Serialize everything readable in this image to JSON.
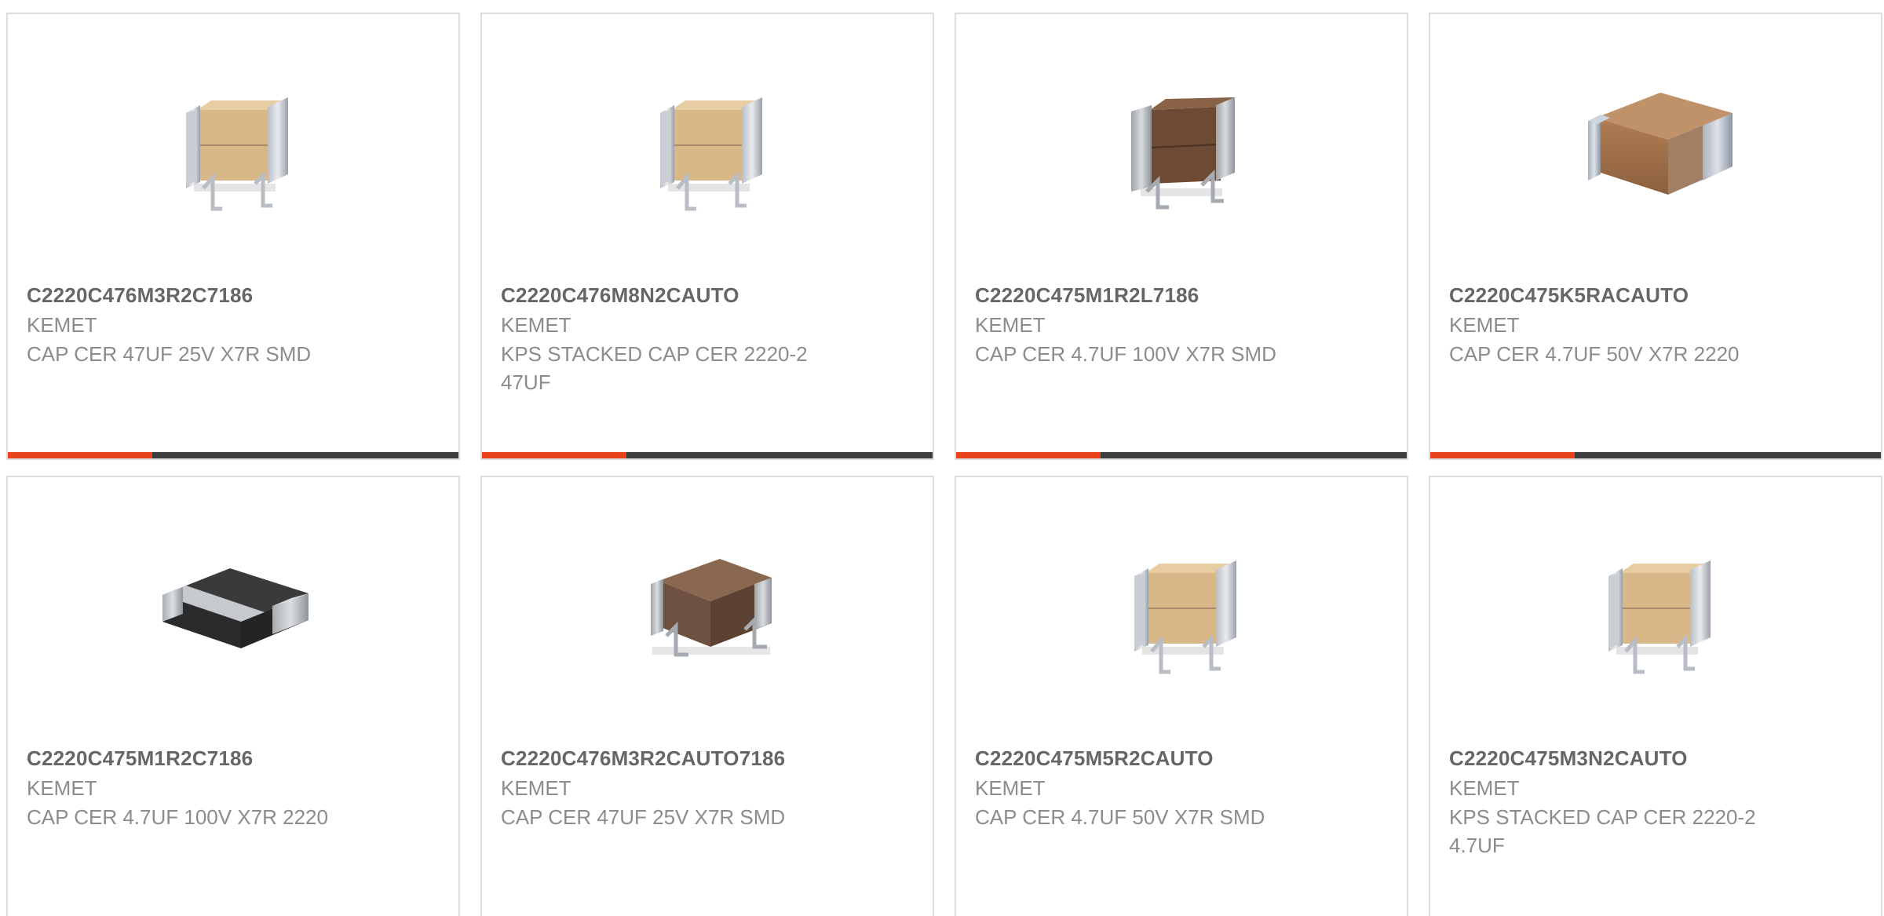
{
  "colors": {
    "accent": "#e8431b",
    "bar_track": "#3e3e3e",
    "border": "#dcdcdc"
  },
  "products": [
    {
      "part_number": "C2220C476M3R2C7186",
      "manufacturer": "KEMET",
      "description": "CAP CER 47UF 25V X7R SMD",
      "image": "stacked-tan-capacitor-icon",
      "progress": 0.32
    },
    {
      "part_number": "C2220C476M8N2CAUTO",
      "manufacturer": "KEMET",
      "description": "KPS STACKED CAP CER 2220-2 47UF",
      "image": "stacked-tan-capacitor-icon",
      "progress": 0.32
    },
    {
      "part_number": "C2220C475M1R2L7186",
      "manufacturer": "KEMET",
      "description": "CAP CER 4.7UF 100V X7R SMD",
      "image": "stacked-brown-capacitor-icon",
      "progress": 0.32
    },
    {
      "part_number": "C2220C475K5RACAUTO",
      "manufacturer": "KEMET",
      "description": "CAP CER 4.7UF 50V X7R 2220",
      "image": "mlcc-brown-chip-icon",
      "progress": 0.32
    },
    {
      "part_number": "C2220C475M1R2C7186",
      "manufacturer": "KEMET",
      "description": "CAP CER 4.7UF 100V X7R 2220",
      "image": "mlcc-black-chip-icon"
    },
    {
      "part_number": "C2220C476M3R2CAUTO7186",
      "manufacturer": "KEMET",
      "description": "CAP CER 47UF 25V X7R SMD",
      "image": "stacked-brown-capacitor-icon"
    },
    {
      "part_number": "C2220C475M5R2CAUTO",
      "manufacturer": "KEMET",
      "description": "CAP CER 4.7UF 50V X7R SMD",
      "image": "stacked-tan-capacitor-icon"
    },
    {
      "part_number": "C2220C475M3N2CAUTO",
      "manufacturer": "KEMET",
      "description": "KPS STACKED CAP CER 2220-2 4.7UF",
      "image": "stacked-tan-capacitor-icon"
    }
  ]
}
